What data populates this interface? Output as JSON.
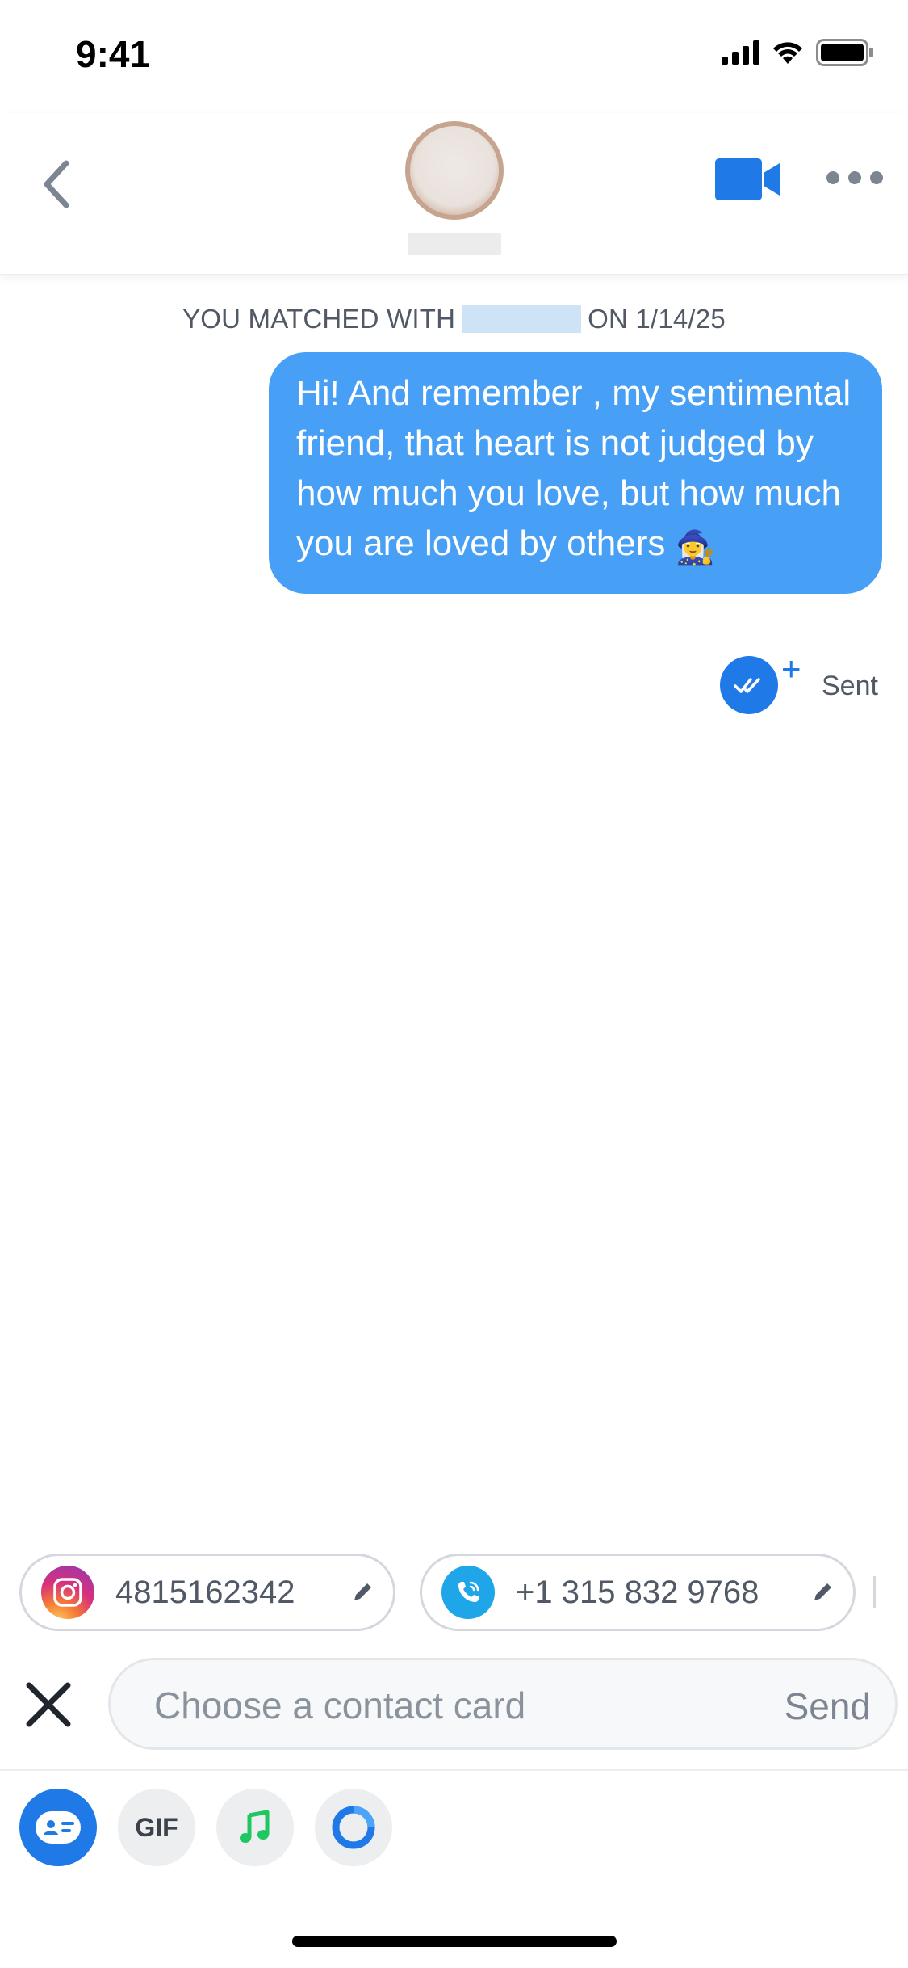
{
  "status_bar": {
    "time": "9:41"
  },
  "header": {
    "back_icon": "chevron-left-icon",
    "video_icon": "video-camera-icon",
    "more_icon": "more-horizontal-icon"
  },
  "chat": {
    "match_prefix": "YOU MATCHED WITH",
    "match_suffix": "ON 1/14/25",
    "message_text": "Hi! And remember , my sentimental friend, that heart is not judged by how much you love, but how much you are loved by others",
    "message_emoji": "🧙‍♀️",
    "receipt_label": "Sent",
    "receipt_plus": "+"
  },
  "contact_chips": [
    {
      "type": "instagram",
      "value": "4815162342",
      "icon": "instagram-icon"
    },
    {
      "type": "phone",
      "value": "+1 315 832 9768",
      "icon": "phone-icon"
    }
  ],
  "composer": {
    "placeholder": "Choose a contact card",
    "value": "",
    "send_label": "Send"
  },
  "toolbar": {
    "gif_label": "GIF",
    "items": [
      "contact-card-icon",
      "gif-icon",
      "music-note-icon",
      "circle-ring-icon"
    ]
  },
  "colors": {
    "bubble": "#47a0f6",
    "accent": "#1f7ae8",
    "text_muted": "#505965"
  }
}
